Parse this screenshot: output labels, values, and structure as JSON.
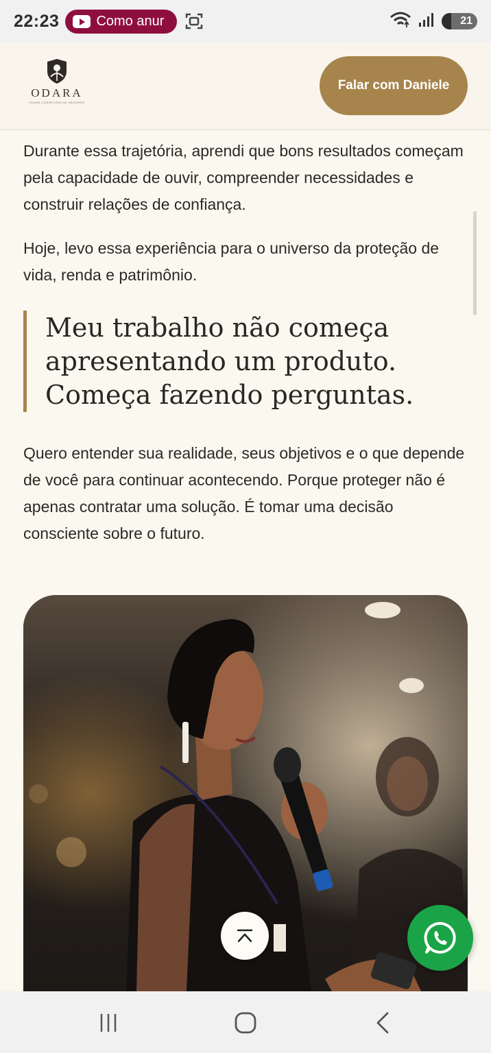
{
  "status_bar": {
    "time": "22:23",
    "notification_pill": "Como anur",
    "battery": "21"
  },
  "header": {
    "logo_name": "ODARA",
    "logo_tagline": "ODARA CORRETORA DE SEGUROS",
    "cta_label": "Falar com Daniele",
    "accent_color": "#a7844c"
  },
  "content": {
    "paragraph_1": "Durante essa trajetória, aprendi que bons resultados começam pela capacidade de ouvir, compreender necessidades e construir relações de confiança.",
    "paragraph_2": "Hoje, levo essa experiência para o universo da proteção de vida, renda e patrimônio.",
    "quote": "Meu trabalho não começa apresentando um produto. Começa fazendo perguntas.",
    "paragraph_3": "Quero entender sua realidade, seus objetivos e o que depende de você para continuar acontecendo. Porque proteger não é apenas contratar uma solução. É tomar uma decisão consciente sobre o futuro."
  },
  "floating": {
    "whatsapp_color": "#1aa447"
  },
  "icons": [
    "youtube-icon",
    "screen-record-icon",
    "wifi-icon",
    "signal-icon",
    "battery-icon",
    "logo-emblem-icon",
    "chevron-up-icon",
    "whatsapp-icon",
    "recents-icon",
    "home-icon",
    "back-icon"
  ]
}
